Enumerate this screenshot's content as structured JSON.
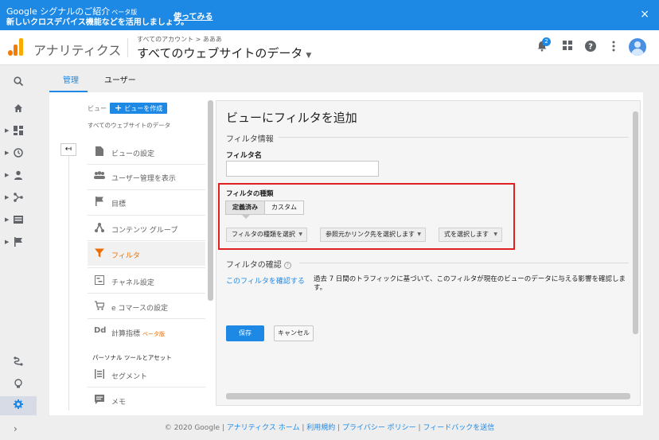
{
  "promo": {
    "title": "Google シグナルのご紹介",
    "title_tag": "ベータ版",
    "subtitle": "新しいクロスデバイス機能などを活用しましょう。",
    "cta": "使ってみる",
    "close": "×"
  },
  "header": {
    "app_name": "アナリティクス",
    "breadcrumb": "すべてのアカウント > あああ",
    "view_name": "すべてのウェブサイトのデータ",
    "notification_count": "2"
  },
  "tabs": [
    {
      "label": "管理"
    },
    {
      "label": "ユーザー"
    }
  ],
  "view_column": {
    "label": "ビュー",
    "create_button": "ビューを作成",
    "view_name": "すべてのウェブサイトのデータ",
    "items": [
      {
        "label": "ビューの設定",
        "icon": "document-icon"
      },
      {
        "label": "ユーザー管理を表示",
        "icon": "people-icon"
      },
      {
        "label": "目標",
        "icon": "flag-icon"
      },
      {
        "label": "コンテンツ グループ",
        "icon": "content-group-icon"
      },
      {
        "label": "フィルタ",
        "icon": "filter-icon"
      },
      {
        "label": "チャネル設定",
        "icon": "channel-icon"
      },
      {
        "label": "e コマースの設定",
        "icon": "cart-icon"
      },
      {
        "label": "計算指標",
        "icon": "calculated-metrics-icon",
        "beta": "ベータ版"
      }
    ],
    "section_label": "パーソナル ツールとアセット",
    "tools": [
      {
        "label": "セグメント",
        "icon": "segment-icon"
      },
      {
        "label": "メモ",
        "icon": "note-icon"
      }
    ]
  },
  "filter_panel": {
    "title": "ビューにフィルタを追加",
    "info_section": "フィルタ情報",
    "name_label": "フィルタ名",
    "name_value": "",
    "type_label": "フィルタの種類",
    "type_options": [
      "定義済み",
      "カスタム"
    ],
    "dropdowns": [
      "フィルタの種類を選択",
      "参照元かリンク先を選択します",
      "式を選択します"
    ],
    "verify_section": "フィルタの確認",
    "verify_link": "このフィルタを確認する",
    "verify_desc": "過去 7 日間のトラフィックに基づいて、このフィルタが現在のビューのデータに与える影響を確認します。",
    "save": "保存",
    "cancel": "キャンセル"
  },
  "footer": {
    "copyright": "© 2020 Google",
    "links": [
      "アナリティクス ホーム",
      "利用規約",
      "プライバシー ポリシー",
      "フィードバックを送信"
    ]
  },
  "colors": {
    "accent": "#1e88e5",
    "active_menu": "#ef6c00",
    "highlight_border": "#e02020"
  }
}
